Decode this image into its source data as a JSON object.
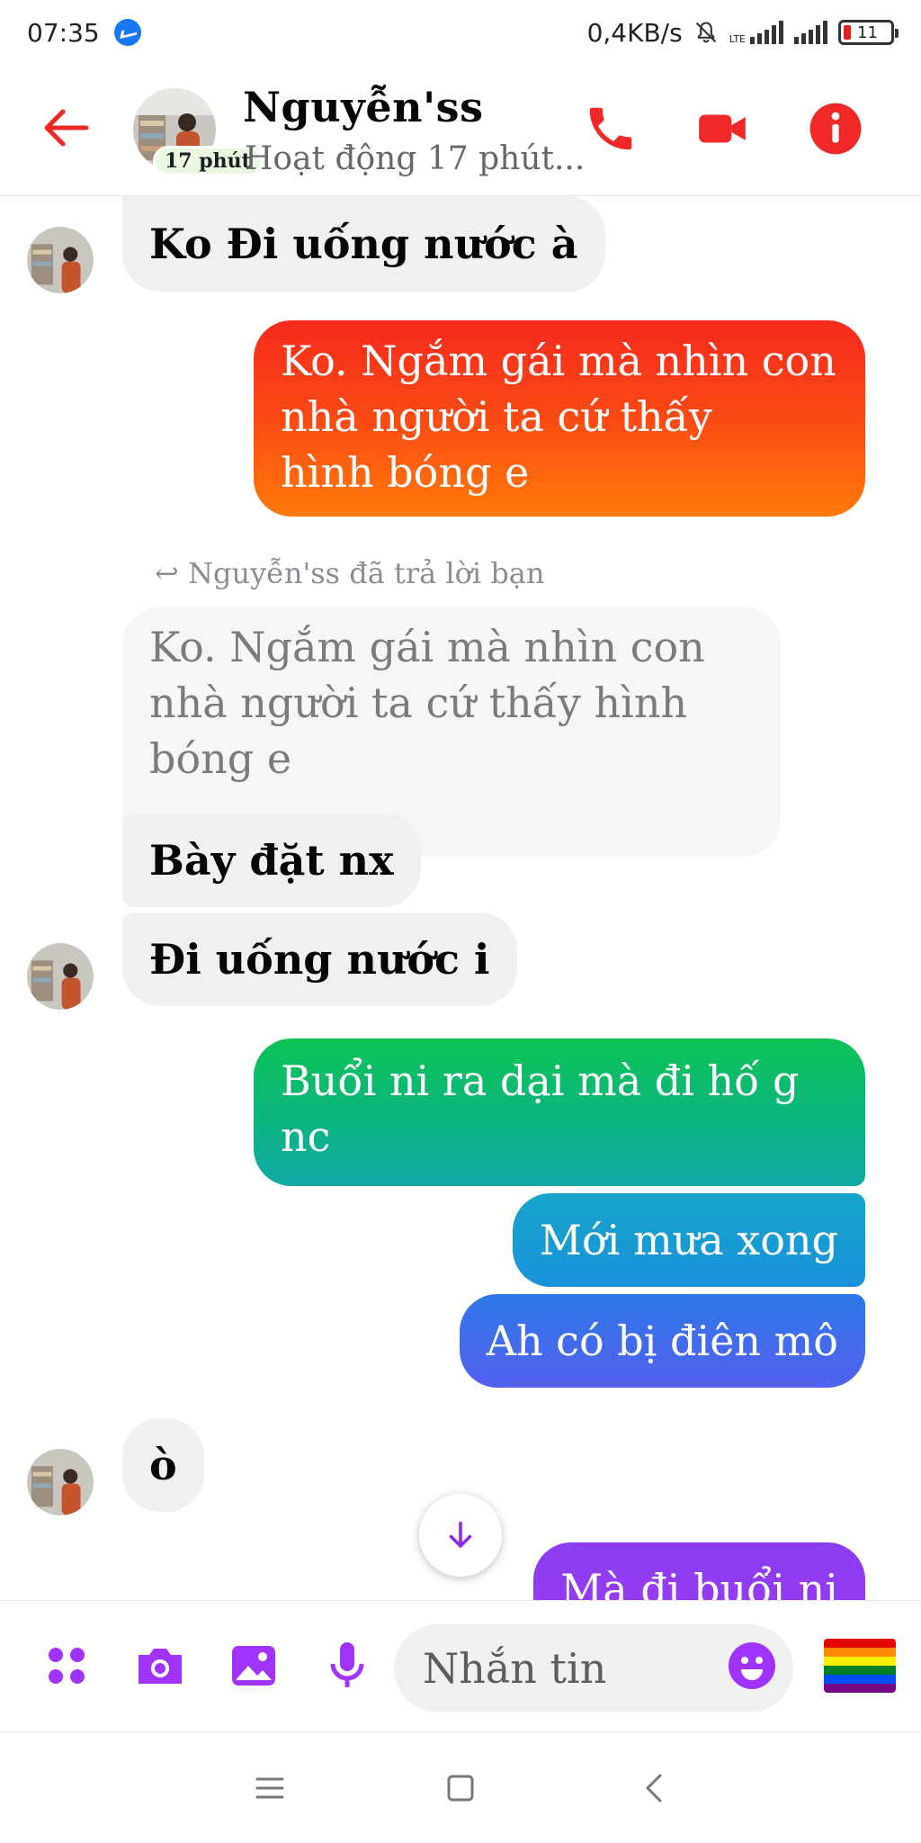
{
  "status_bar": {
    "time": "07:35",
    "network_speed": "0,4KB/s",
    "network_type": "LTE",
    "battery": "11"
  },
  "header": {
    "contact_name": "Nguyễn'ss",
    "active_badge": "17 phút",
    "status": "Hoạt động 17 phút..."
  },
  "messages": {
    "m1": "Ko Đi uống nước à",
    "m2": [
      "Ko. Ngắm gái mà nhìn con",
      "nhà  người ta  cứ thấy",
      "hình  bóng e"
    ],
    "reply_note": "Nguyễn'ss đã trả lời bạn",
    "quoted": [
      "Ko. Ngắm gái mà nhìn con",
      "nhà  người ta  cứ thấy hình",
      "bóng e"
    ],
    "m3": "Bày đặt nx",
    "m4": "Đi uống nước i",
    "m5": [
      "Buổi ni ra dại mà đi hố g",
      "nc"
    ],
    "m6": "Mới mưa xong",
    "m7": "Ah có bị điên mô",
    "m8": "ò",
    "m9": "Mà đi buổi ni"
  },
  "composer": {
    "placeholder": "Nhắn tin"
  },
  "colors": {
    "accent_red": "#f02828",
    "accent_purple": "#a033ff",
    "incoming_bg": "#f0f0f0"
  }
}
